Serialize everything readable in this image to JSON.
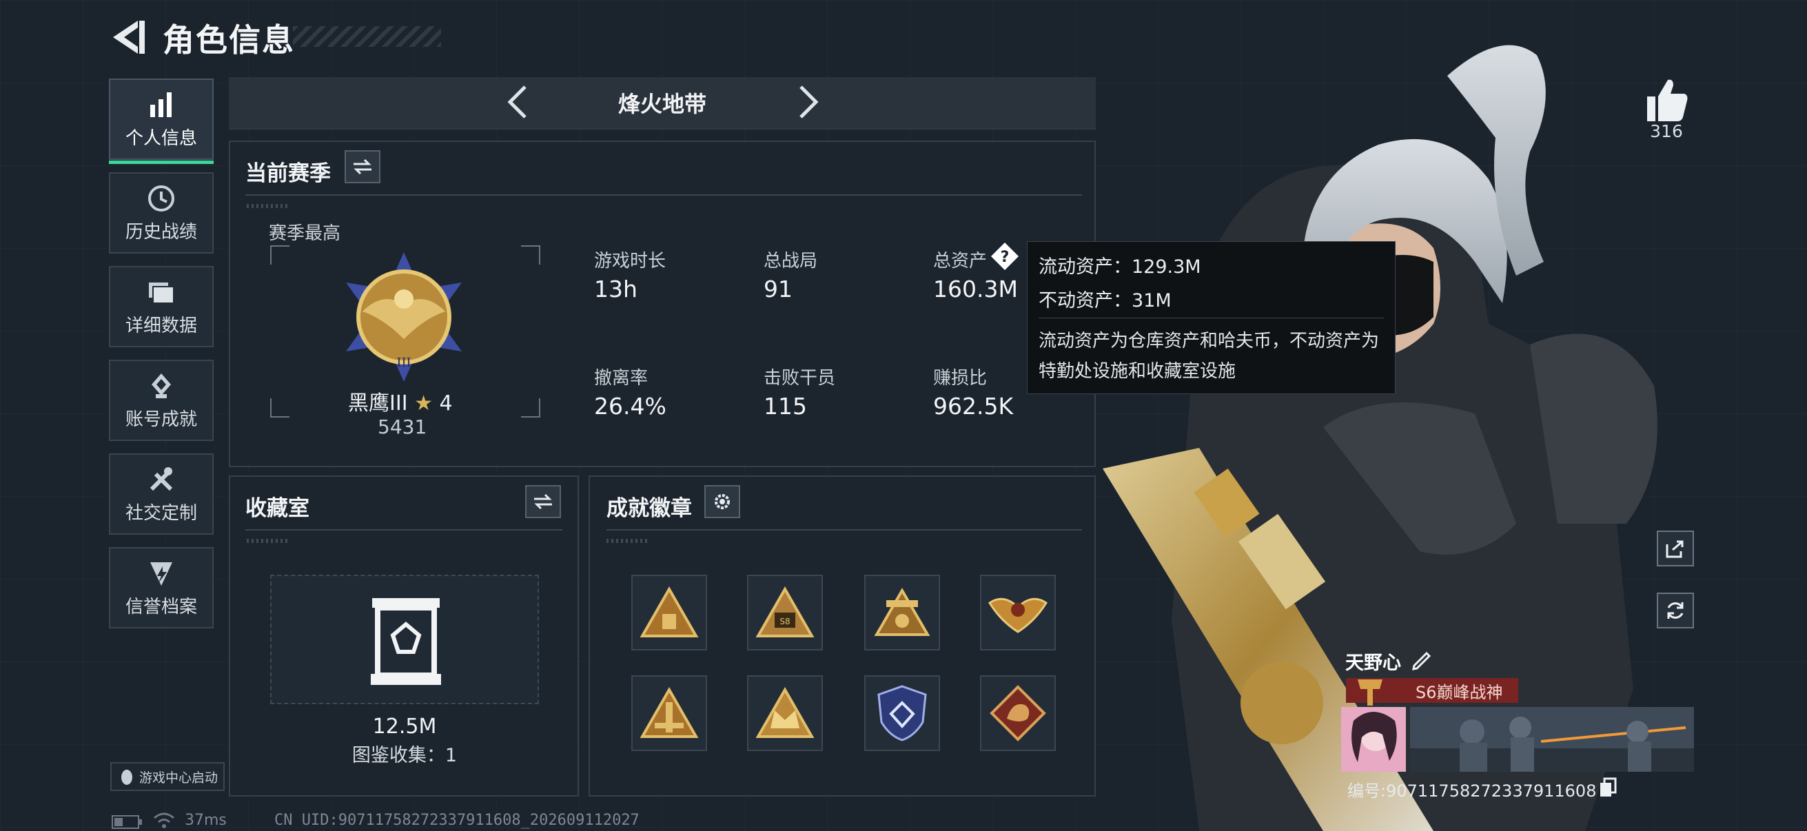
{
  "header": {
    "title": "角色信息"
  },
  "sidebar": {
    "items": [
      {
        "label": "个人信息",
        "icon": "bar-chart-icon",
        "active": true
      },
      {
        "label": "历史战绩",
        "icon": "history-icon"
      },
      {
        "label": "详细数据",
        "icon": "folder-icon"
      },
      {
        "label": "账号成就",
        "icon": "achievement-icon"
      },
      {
        "label": "社交定制",
        "icon": "tools-icon"
      },
      {
        "label": "信誉档案",
        "icon": "credit-shield-icon"
      }
    ],
    "launch_label": "游戏中心启动"
  },
  "mode": {
    "title": "烽火地带"
  },
  "season": {
    "title": "当前赛季",
    "best_label": "赛季最高",
    "rank_name": "黑鹰III",
    "rank_stars": "4",
    "rank_score": "5431",
    "stats": [
      {
        "label": "游戏时长",
        "value": "13h"
      },
      {
        "label": "总战局",
        "value": "91"
      },
      {
        "label": "总资产",
        "value": "160.3M"
      },
      {
        "label": "撤离率",
        "value": "26.4%"
      },
      {
        "label": "击败干员",
        "value": "115"
      },
      {
        "label": "赚损比",
        "value": "962.5K"
      }
    ]
  },
  "tooltip": {
    "liquid": "流动资产：129.3M",
    "fixed": "不动资产：31M",
    "note": "流动资产为仓库资产和哈夫币，不动资产为特勤处设施和收藏室设施"
  },
  "collection": {
    "title": "收藏室",
    "value": "12.5M",
    "count": "图鉴收集：1"
  },
  "achievements": {
    "title": "成就徽章"
  },
  "social": {
    "likes": "316"
  },
  "player": {
    "name": "天野心",
    "rank_tag": "S6巅峰战神",
    "id": "编号:9071175827233791160​8"
  },
  "status": {
    "ping": "37ms",
    "uid": "CN UID:90711758272337911608_20260911202​7"
  },
  "colors": {
    "accent": "#3bd89a",
    "rank_tag": "#7a2323",
    "gold": "#c99a3a"
  }
}
